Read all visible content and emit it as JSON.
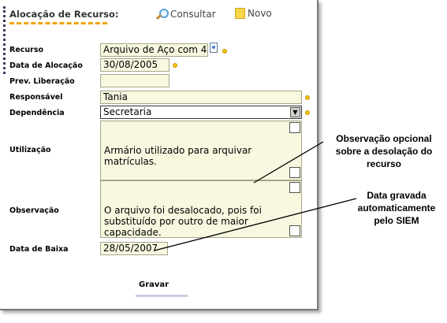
{
  "header": {
    "title": "Alocação de Recurso:",
    "consultar_label": "Consultar",
    "novo_label": "Novo"
  },
  "form": {
    "recurso": {
      "label": "Recurso",
      "value": "Arquivo de Aço com 4"
    },
    "data_alocacao": {
      "label": "Data de Alocação",
      "value": "30/08/2005"
    },
    "prev_liberacao": {
      "label": "Prev. Liberação",
      "value": ""
    },
    "responsavel": {
      "label": "Responsável",
      "value": "Tania"
    },
    "dependencia": {
      "label": "Dependência",
      "value": "Secretaria"
    },
    "utilizacao": {
      "label": "Utilização",
      "value": "Armário utilizado para arquivar\nmatrículas."
    },
    "observacao": {
      "label": "Observação",
      "value": "O arquivo foi desalocado, pois foi\nsubstituído por outro de maior\ncapacidade."
    },
    "data_baixa": {
      "label": "Data de Baixa",
      "value": "28/05/2007"
    }
  },
  "actions": {
    "gravar_label": "Gravar"
  },
  "annotations": {
    "observacao_note": "Observação opcional\nsobre a desolação do\nrecurso",
    "data_note": "Data gravada\nautomaticamente\npelo SIEM"
  },
  "colors": {
    "required_dot": "#f2c200",
    "field_bg": "#f8f8e0",
    "title_underline": "#f0a400"
  },
  "icons": {
    "consultar": "search-icon",
    "novo": "new-icon",
    "recurso_lookup": "document-icon",
    "dependencia_dropdown": "chevron-down-icon"
  }
}
